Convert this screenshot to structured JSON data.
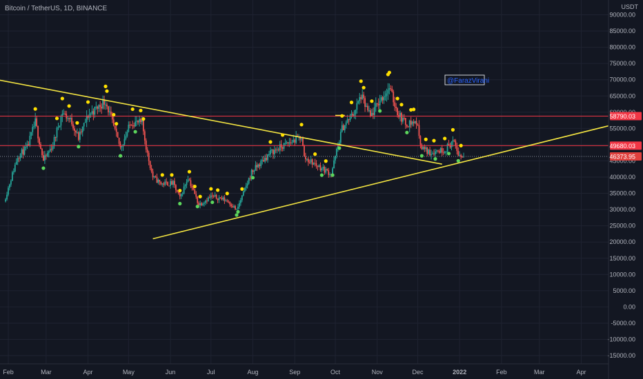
{
  "header": {
    "title": "Bitcoin / TetherUS, 1D, BINANCE",
    "currency": "USDT"
  },
  "watermark": "@FarazVirani",
  "colors": {
    "background": "#131722",
    "grid": "#1f2331",
    "up_candle": "#26a69a",
    "down_candle": "#ef5350",
    "trendline": "#f5e642",
    "level_line": "#f23645",
    "dot_yellow": "#ffe000",
    "dot_green": "#5cd65c",
    "axis_text": "#b2b5be",
    "watermark_text": "#2962ff"
  },
  "chart_data": {
    "type": "candlestick",
    "x_ticks": [
      "Feb",
      "Mar",
      "Apr",
      "May",
      "Jun",
      "Jul",
      "Aug",
      "Sep",
      "Oct",
      "Nov",
      "Dec",
      "2022",
      "Feb",
      "Mar",
      "Apr"
    ],
    "y_ticks": [
      90000,
      85000,
      80000,
      75000,
      70000,
      65000,
      60000,
      55000,
      50000,
      45000,
      40000,
      35000,
      30000,
      25000,
      20000,
      15000,
      10000,
      5000,
      0,
      -5000,
      -10000,
      -15000
    ],
    "y_tick_labels": [
      "90000.00",
      "85000.00",
      "80000.00",
      "75000.00",
      "70000.00",
      "65000.00",
      "60000.00",
      "55000.00",
      "50000.00",
      "45000.00",
      "40000.00",
      "35000.00",
      "30000.00",
      "25000.00",
      "20000.00",
      "15000.00",
      "10000.00",
      "5000.00",
      "0.00",
      "-5000.00",
      "-10000.00",
      "-15000.00"
    ],
    "price_labels": [
      {
        "value": 58790.03,
        "label": "58790.03",
        "style": "level"
      },
      {
        "value": 49680.03,
        "label": "49680.03",
        "style": "level"
      },
      {
        "value": 46373.95,
        "label": "46373.95",
        "style": "last"
      }
    ],
    "horizontal_lines": [
      58790.03,
      49680.03
    ],
    "trendlines": [
      {
        "from": [
          "2021-01-24",
          70000
        ],
        "to": [
          "2021-12-19",
          44000
        ]
      },
      {
        "from": [
          "2021-05-19",
          21000
        ],
        "to": [
          "2022-04-28",
          56500
        ]
      },
      {
        "from": [
          "2021-10-01",
          59000
        ],
        "to": [
          "2021-10-08",
          59000
        ]
      }
    ],
    "price_path": [
      [
        "2021-01-29",
        32500
      ],
      [
        "2021-02-08",
        46500
      ],
      [
        "2021-02-15",
        49000
      ],
      [
        "2021-02-21",
        57000
      ],
      [
        "2021-02-27",
        45000
      ],
      [
        "2021-03-06",
        50000
      ],
      [
        "2021-03-13",
        60000
      ],
      [
        "2021-03-20",
        57000
      ],
      [
        "2021-03-25",
        52000
      ],
      [
        "2021-04-01",
        59000
      ],
      [
        "2021-04-14",
        63500
      ],
      [
        "2021-04-21",
        54000
      ],
      [
        "2021-04-25",
        49000
      ],
      [
        "2021-05-03",
        57000
      ],
      [
        "2021-05-11",
        56500
      ],
      [
        "2021-05-15",
        47000
      ],
      [
        "2021-05-19",
        40000
      ],
      [
        "2021-05-25",
        38000
      ],
      [
        "2021-06-03",
        38000
      ],
      [
        "2021-06-08",
        33500
      ],
      [
        "2021-06-14",
        40000
      ],
      [
        "2021-06-22",
        31500
      ],
      [
        "2021-07-01",
        34000
      ],
      [
        "2021-07-08",
        33500
      ],
      [
        "2021-07-14",
        32500
      ],
      [
        "2021-07-20",
        29800
      ],
      [
        "2021-07-25",
        35000
      ],
      [
        "2021-07-31",
        41500
      ],
      [
        "2021-08-14",
        47500
      ],
      [
        "2021-08-23",
        49500
      ],
      [
        "2021-09-06",
        52500
      ],
      [
        "2021-09-08",
        46000
      ],
      [
        "2021-09-20",
        43000
      ],
      [
        "2021-09-28",
        41000
      ],
      [
        "2021-10-06",
        55000
      ],
      [
        "2021-10-15",
        60000
      ],
      [
        "2021-10-20",
        65000
      ],
      [
        "2021-10-27",
        58500
      ],
      [
        "2021-11-02",
        63000
      ],
      [
        "2021-11-10",
        67500
      ],
      [
        "2021-11-16",
        60000
      ],
      [
        "2021-11-22",
        56500
      ],
      [
        "2021-11-30",
        57000
      ],
      [
        "2021-12-04",
        49000
      ],
      [
        "2021-12-10",
        47500
      ],
      [
        "2021-12-14",
        48000
      ],
      [
        "2021-12-21",
        48500
      ],
      [
        "2021-12-27",
        51000
      ],
      [
        "2022-01-01",
        46500
      ],
      [
        "2022-01-04",
        46373.95
      ]
    ],
    "yellow_dot_dates": [
      "2021-02-21",
      "2021-03-09",
      "2021-03-13",
      "2021-03-18",
      "2021-03-24",
      "2021-04-01",
      "2021-04-14",
      "2021-04-15",
      "2021-04-20",
      "2021-04-22",
      "2021-05-04",
      "2021-05-10",
      "2021-05-12",
      "2021-05-26",
      "2021-06-02",
      "2021-06-08",
      "2021-06-15",
      "2021-06-19",
      "2021-06-23",
      "2021-07-01",
      "2021-07-06",
      "2021-07-13",
      "2021-07-24",
      "2021-08-14",
      "2021-08-23",
      "2021-09-06",
      "2021-09-16",
      "2021-09-24",
      "2021-10-06",
      "2021-10-13",
      "2021-10-20",
      "2021-10-22",
      "2021-10-28",
      "2021-11-09",
      "2021-11-10",
      "2021-11-16",
      "2021-11-19",
      "2021-11-26",
      "2021-11-28",
      "2021-12-07",
      "2021-12-13",
      "2021-12-21",
      "2021-12-27",
      "2022-01-02"
    ],
    "green_dot_dates": [
      "2021-02-27",
      "2021-03-25",
      "2021-04-25",
      "2021-05-06",
      "2021-06-08",
      "2021-06-21",
      "2021-07-02",
      "2021-07-20",
      "2021-07-21",
      "2021-08-01",
      "2021-09-21",
      "2021-09-29",
      "2021-10-04",
      "2021-11-03",
      "2021-11-23",
      "2021-12-04",
      "2021-12-14",
      "2021-12-24",
      "2021-12-31"
    ]
  }
}
